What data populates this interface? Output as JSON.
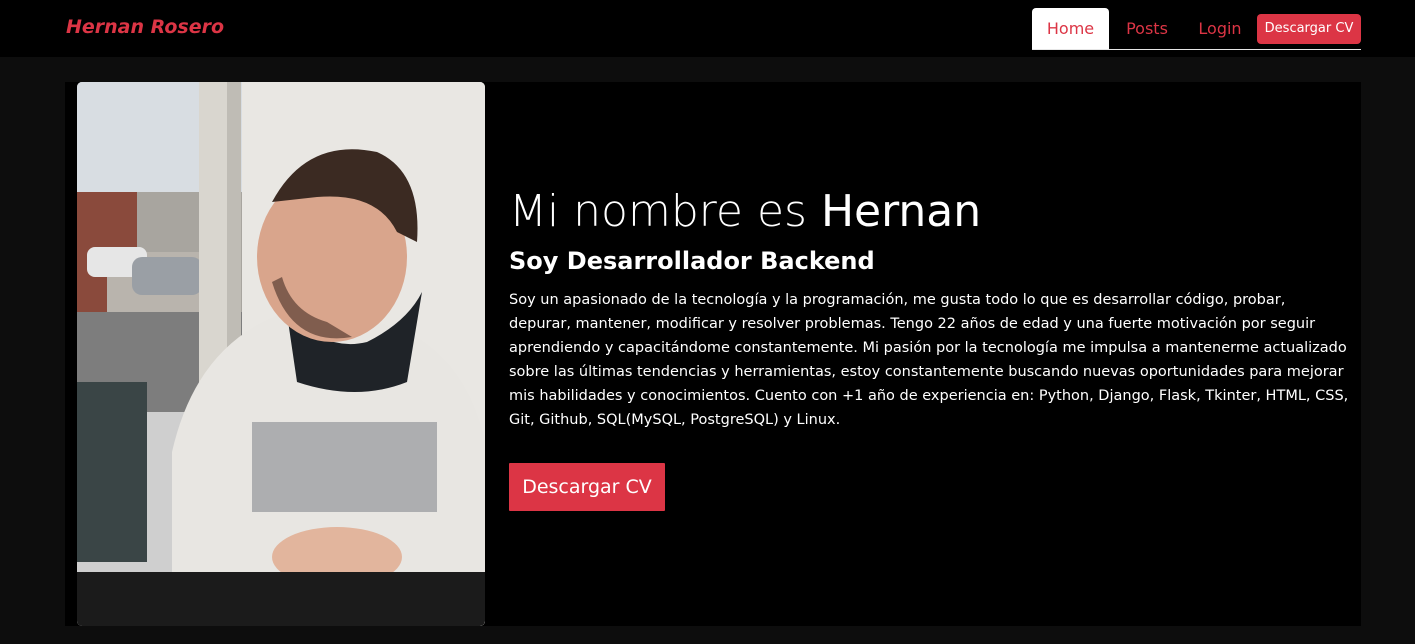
{
  "navbar": {
    "brand": "Hernan Rosero",
    "links": [
      {
        "label": "Home",
        "active": true
      },
      {
        "label": "Posts",
        "active": false
      },
      {
        "label": "Login",
        "active": false
      }
    ],
    "cv_button": "Descargar CV"
  },
  "hero": {
    "title_prefix": "Mi nombre es ",
    "title_name": "Hernan",
    "subtitle": "Soy Desarrollador Backend",
    "description": "Soy un apasionado de la tecnología y la programación, me gusta todo lo que es desarrollar código, probar, depurar, mantener, modificar y resolver problemas. Tengo 22 años de edad y una fuerte motivación por seguir aprendiendo y capacitándome constantemente. Mi pasión por la tecnología me impulsa a mantenerme actualizado sobre las últimas tendencias y herramientas, estoy constantemente buscando nuevas oportunidades para mejorar mis habilidades y conocimientos. Cuento con +1 año de experiencia en: Python, Django, Flask, Tkinter, HTML, CSS, Git, Github, SQL(MySQL, PostgreSQL) y Linux.",
    "cv_button": "Descargar CV",
    "photo_alt": "profile-photo"
  },
  "colors": {
    "accent": "#dc3545",
    "navbar_bg": "#000000",
    "page_bg": "#0d0d0d",
    "hero_bg": "#000000",
    "text": "#ffffff"
  }
}
